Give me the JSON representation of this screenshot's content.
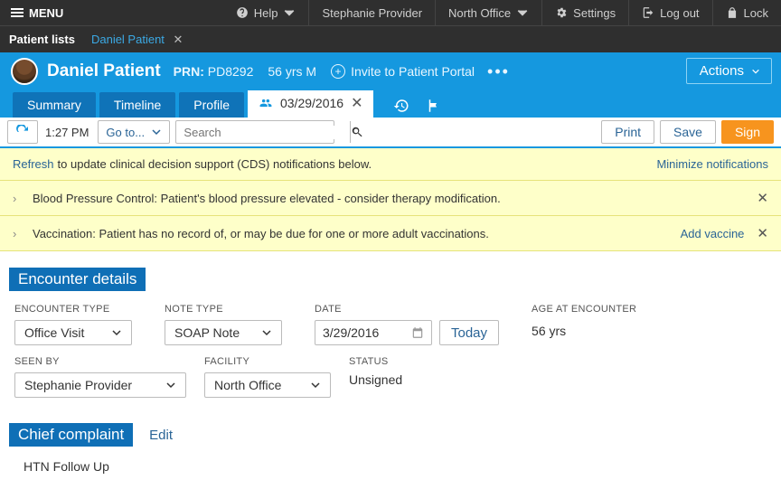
{
  "topbar": {
    "menu": "MENU",
    "help": "Help",
    "provider": "Stephanie Provider",
    "office": "North Office",
    "settings": "Settings",
    "logout": "Log out",
    "lock": "Lock"
  },
  "tabs": {
    "patient_lists": "Patient lists",
    "active": "Daniel Patient"
  },
  "patient": {
    "name": "Daniel Patient",
    "prn_label": "PRN:",
    "prn_value": "PD8292",
    "age": "56 yrs M",
    "invite": "Invite to Patient Portal",
    "actions": "Actions"
  },
  "nav": {
    "summary": "Summary",
    "timeline": "Timeline",
    "profile": "Profile",
    "encounter_date": "03/29/2016"
  },
  "toolbar": {
    "time": "1:27 PM",
    "goto": "Go to...",
    "search_placeholder": "Search",
    "print": "Print",
    "save": "Save",
    "sign": "Sign"
  },
  "cds": {
    "refresh": "Refresh",
    "refresh_tail": "to update clinical decision support (CDS) notifications below.",
    "minimize": "Minimize notifications",
    "rows": [
      {
        "text": "Blood Pressure Control: Patient's blood pressure elevated - consider therapy modification."
      },
      {
        "text": "Vaccination: Patient has no record of, or may be due for one or more adult vaccinations.",
        "action": "Add vaccine"
      }
    ]
  },
  "encounter": {
    "heading": "Encounter details",
    "labels": {
      "type": "ENCOUNTER TYPE",
      "note": "NOTE TYPE",
      "date": "DATE",
      "age": "AGE AT ENCOUNTER",
      "seen_by": "SEEN BY",
      "facility": "FACILITY",
      "status": "STATUS"
    },
    "type_value": "Office Visit",
    "note_value": "SOAP Note",
    "date_value": "3/29/2016",
    "today": "Today",
    "age_value": "56 yrs",
    "seen_by_value": "Stephanie Provider",
    "facility_value": "North Office",
    "status_value": "Unsigned"
  },
  "chief": {
    "heading": "Chief complaint",
    "edit": "Edit",
    "value": "HTN Follow Up"
  }
}
